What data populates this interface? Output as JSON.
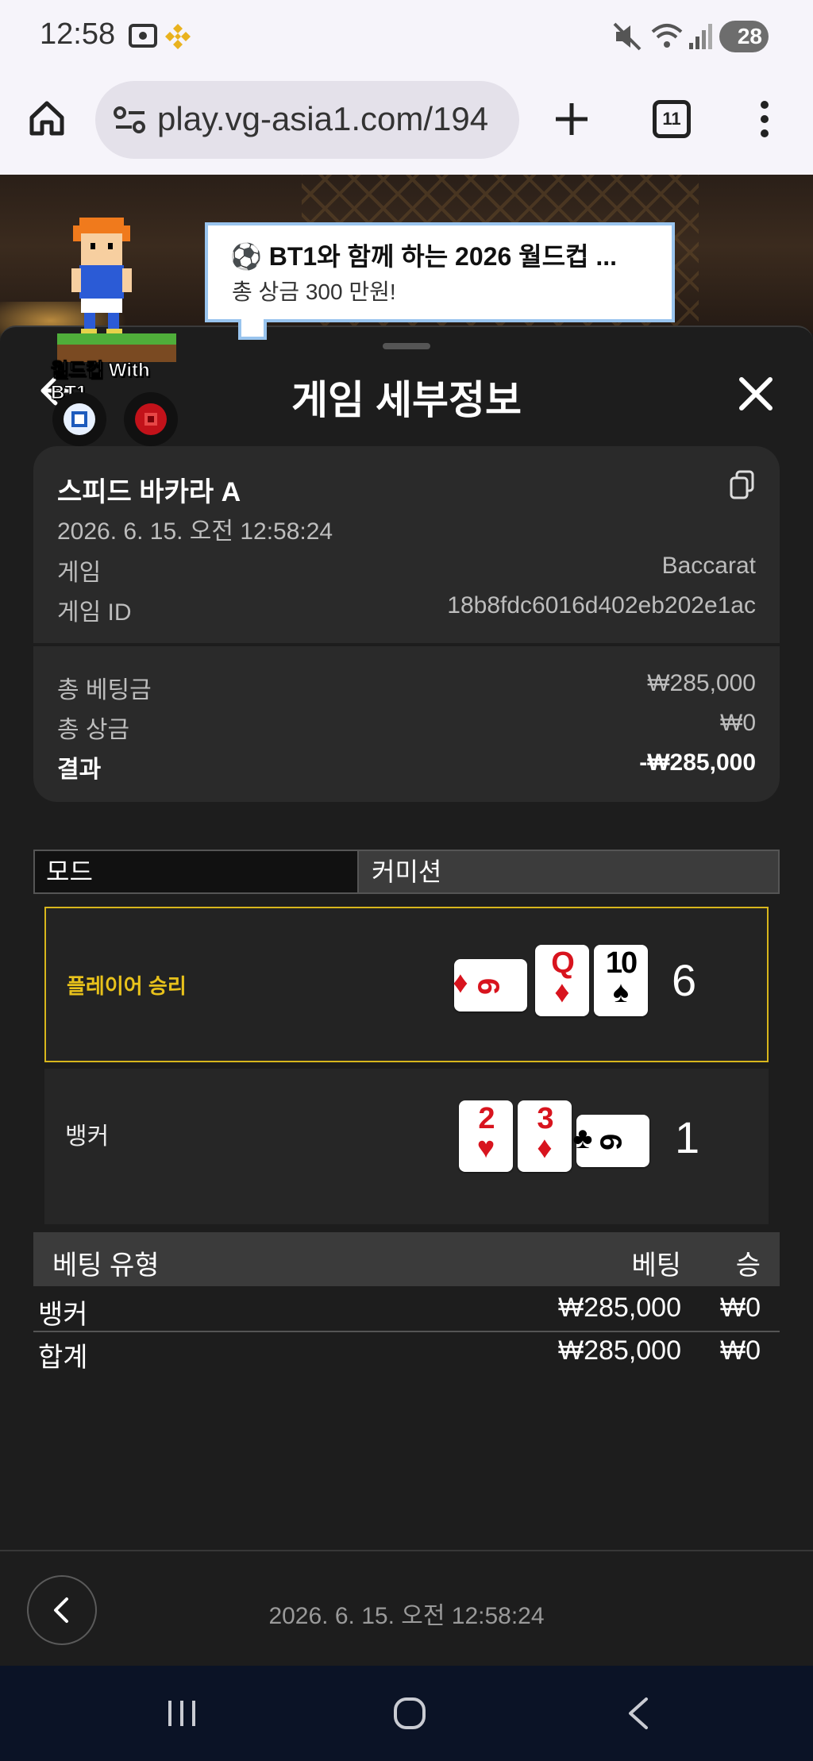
{
  "status_bar": {
    "time": "12:58",
    "battery": "28"
  },
  "browser": {
    "url": "play.vg-asia1.com/194",
    "tab_count": "11"
  },
  "promo": {
    "title": "⚽ BT1와 함께 하는 2026 월드컵 ...",
    "subtitle": "총 상금 300 만원!",
    "badge": "월드컵 With BT1"
  },
  "panel": {
    "title": "게임 세부정보",
    "game_name": "스피드 바카라 A",
    "datetime": "2026. 6. 15. 오전 12:58:24",
    "game_label": "게임",
    "game_value": "Baccarat",
    "game_id_label": "게임 ID",
    "game_id_value": "18b8fdc6016d402eb202e1ac",
    "total_bet_label": "총 베팅금",
    "total_bet_value": "₩285,000",
    "total_win_label": "총 상금",
    "total_win_value": "₩0",
    "result_label": "결과",
    "result_value": "-₩285,000"
  },
  "mode": {
    "left": "모드",
    "right": "커미션"
  },
  "player": {
    "label": "플레이어 승리",
    "score": "6",
    "cards": [
      {
        "rank": "6",
        "suit": "♦",
        "color": "#d8141e",
        "orientation": "sideways"
      },
      {
        "rank": "Q",
        "suit": "♦",
        "color": "#d8141e",
        "orientation": "upright"
      },
      {
        "rank": "10",
        "suit": "♠",
        "color": "#000000",
        "orientation": "upright"
      }
    ]
  },
  "banker": {
    "label": "뱅커",
    "score": "1",
    "cards": [
      {
        "rank": "2",
        "suit": "♥",
        "color": "#d8141e",
        "orientation": "upright"
      },
      {
        "rank": "3",
        "suit": "♦",
        "color": "#d8141e",
        "orientation": "upright"
      },
      {
        "rank": "6",
        "suit": "♣",
        "color": "#000000",
        "orientation": "sideways"
      }
    ]
  },
  "bets": {
    "headers": {
      "type": "베팅 유형",
      "bet": "베팅",
      "win": "승"
    },
    "rows": [
      {
        "type": "뱅커",
        "bet": "₩285,000",
        "win": "₩0"
      },
      {
        "type": "합계",
        "bet": "₩285,000",
        "win": "₩0"
      }
    ]
  },
  "footer": {
    "datetime": "2026. 6. 15. 오전 12:58:24"
  },
  "colors": {
    "win_highlight": "#d8b61c",
    "panel_bg": "#1d1d1d",
    "card_bg": "#2a2a2a",
    "nav_bar": "#0b1326"
  }
}
